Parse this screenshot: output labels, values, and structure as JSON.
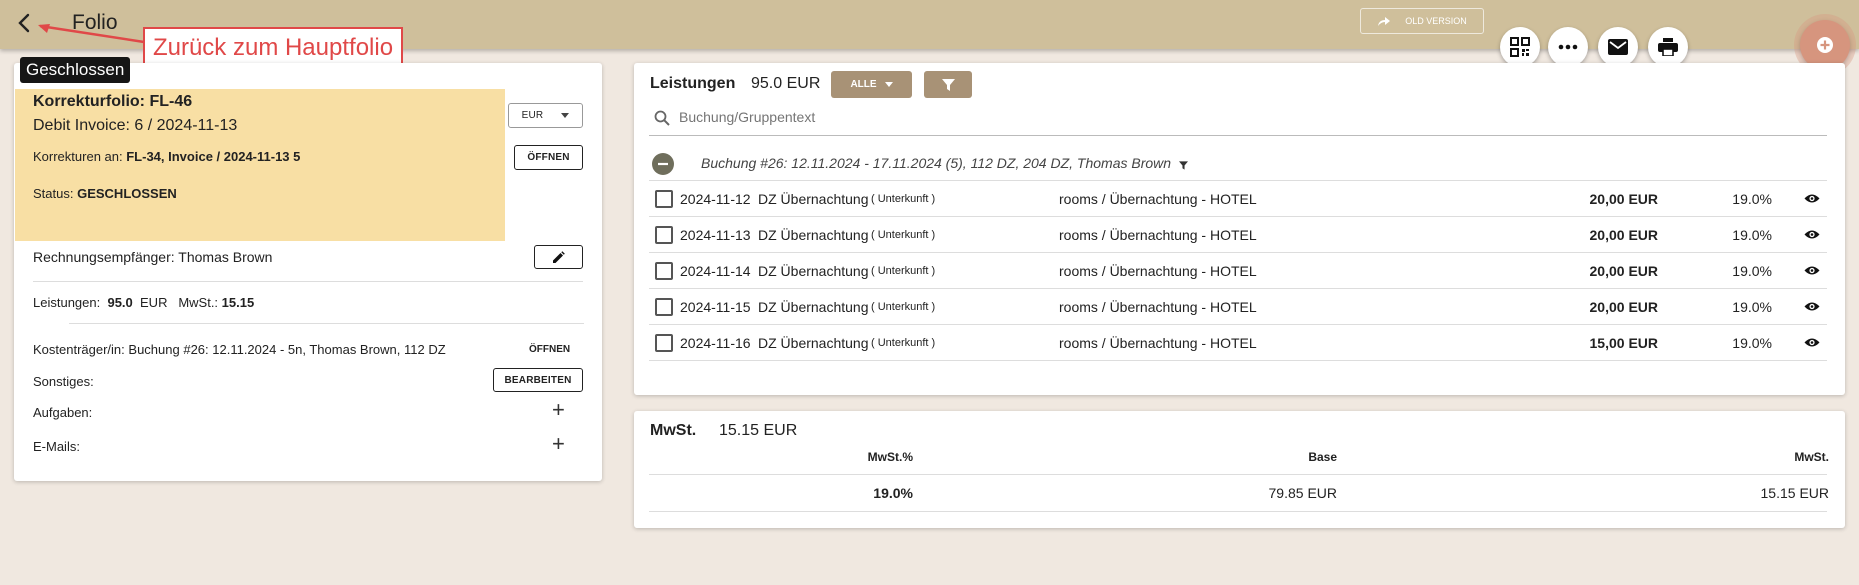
{
  "header": {
    "title": "Folio",
    "old_version_label": "OLD VERSION"
  },
  "annotation": {
    "text": "Zurück zum Hauptfolio",
    "color": "#e04848"
  },
  "left": {
    "badge": "Geschlossen",
    "folio_title": "Korrekturfolio: FL-46",
    "debit_invoice": "Debit Invoice: 6 / 2024-11-13",
    "corrections_label": "Korrekturen an:",
    "corrections_value": "FL-34, Invoice / 2024-11-13 5",
    "status_label": "Status:",
    "status_value": "GESCHLOSSEN",
    "currency": "EUR",
    "open_label": "ÖFFNEN",
    "recipient_label": "Rechnungsempfänger:",
    "recipient_value": "Thomas Brown",
    "services_label": "Leistungen:",
    "services_value": "95.0",
    "services_currency": "EUR",
    "vat_label": "MwSt.:",
    "vat_value": "15.15",
    "cost_bearer_label": "Kostenträger/in:",
    "cost_bearer_value": "Buchung #26: 12.11.2024 - 5n, Thomas Brown, 112 DZ",
    "cost_bearer_open": "ÖFFNEN",
    "misc_label": "Sonstiges:",
    "edit_label": "BEARBEITEN",
    "tasks_label": "Aufgaben:",
    "emails_label": "E-Mails:"
  },
  "services": {
    "title": "Leistungen",
    "total": "95.0 EUR",
    "filter_all": "ALLE",
    "search_placeholder": "Buchung/Gruppentext",
    "group_label": "Buchung #26: 12.11.2024 - 17.11.2024 (5), 112 DZ, 204 DZ, Thomas Brown",
    "rows": [
      {
        "date": "2024-11-12",
        "name": "DZ Übernachtung",
        "tag": "( Unterkunft )",
        "account": "rooms / Übernachtung - HOTEL",
        "amount": "20,00 EUR",
        "vat": "19.0%"
      },
      {
        "date": "2024-11-13",
        "name": "DZ Übernachtung",
        "tag": "( Unterkunft )",
        "account": "rooms / Übernachtung - HOTEL",
        "amount": "20,00 EUR",
        "vat": "19.0%"
      },
      {
        "date": "2024-11-14",
        "name": "DZ Übernachtung",
        "tag": "( Unterkunft )",
        "account": "rooms / Übernachtung - HOTEL",
        "amount": "20,00 EUR",
        "vat": "19.0%"
      },
      {
        "date": "2024-11-15",
        "name": "DZ Übernachtung",
        "tag": "( Unterkunft )",
        "account": "rooms / Übernachtung - HOTEL",
        "amount": "20,00 EUR",
        "vat": "19.0%"
      },
      {
        "date": "2024-11-16",
        "name": "DZ Übernachtung",
        "tag": "( Unterkunft )",
        "account": "rooms / Übernachtung - HOTEL",
        "amount": "15,00 EUR",
        "vat": "19.0%"
      }
    ]
  },
  "tax": {
    "title": "MwSt.",
    "total": "15.15 EUR",
    "headers": {
      "rate": "MwSt.%",
      "base": "Base",
      "vat": "MwSt."
    },
    "row": {
      "rate": "19.0%",
      "base": "79.85 EUR",
      "vat": "15.15 EUR"
    }
  },
  "colors": {
    "header": "#cfbf9b",
    "accent_tan": "#a89276",
    "closed_yellow": "#f8dfa4",
    "fab": "#d6957e"
  },
  "icons": [
    "back-icon",
    "share-icon",
    "qr-code-icon",
    "more-icon",
    "mail-icon",
    "print-icon",
    "add-icon",
    "search-icon",
    "filter-icon",
    "collapse-icon",
    "visibility-icon",
    "edit-icon",
    "caret-down-icon"
  ]
}
